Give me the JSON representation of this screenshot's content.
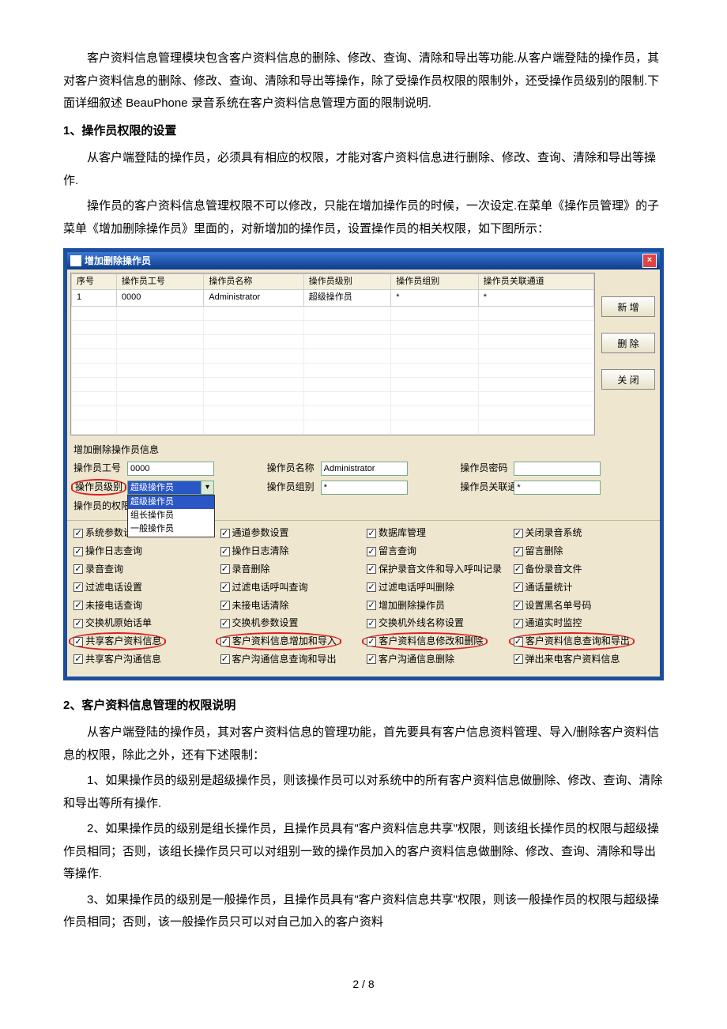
{
  "intro_p1": "客户资料信息管理模块包含客户资料信息的删除、修改、查询、清除和导出等功能.从客户端登陆的操作员，其对客户资料信息的删除、修改、查询、清除和导出等操作，除了受操作员权限的限制外，还受操作员级别的限制.下面详细叙述 BeauPhone 录音系统在客户资料信息管理方面的限制说明.",
  "h1": "1、操作员权限的设置",
  "s1_p1": "从客户端登陆的操作员，必须具有相应的权限，才能对客户资料信息进行删除、修改、查询、清除和导出等操作.",
  "s1_p2": "操作员的客户资料信息管理权限不可以修改，只能在增加操作员的时候，一次设定.在菜单《操作员管理》的子菜单《增加删除操作员》里面的，对新增加的操作员，设置操作员的相关权限，如下图所示：",
  "dlg": {
    "title": "增加删除操作员",
    "cols": [
      "序号",
      "操作员工号",
      "操作员名称",
      "操作员级别",
      "操作员组别",
      "操作员关联通道"
    ],
    "row": [
      "1",
      "0000",
      "Administrator",
      "超级操作员",
      "*",
      "*"
    ],
    "btn_add": "新 增",
    "btn_del": "删 除",
    "btn_close": "关 闭",
    "section": "增加删除操作员信息",
    "lbl_id": "操作员工号",
    "val_id": "0000",
    "lbl_name": "操作员名称",
    "val_name": "Administrator",
    "lbl_pwd": "操作员密码",
    "val_pwd": "",
    "lbl_level": "操作员级别",
    "val_level": "超级操作员",
    "opts": [
      "超级操作员",
      "组长操作员",
      "一般操作员"
    ],
    "lbl_group": "操作员组别",
    "val_group": "*",
    "lbl_chan": "操作员关联通道",
    "val_chan": "*",
    "lbl_perm": "操作员的权限",
    "perm_rows": [
      [
        "系统参数设置",
        "通道参数设置",
        "数据库管理",
        "关闭录音系统"
      ],
      [
        "操作日志查询",
        "操作日志清除",
        "留言查询",
        "留言删除"
      ],
      [
        "录音查询",
        "录音删除",
        "保护录音文件和导入呼叫记录",
        "备份录音文件"
      ],
      [
        "过滤电话设置",
        "过滤电话呼叫查询",
        "过滤电话呼叫删除",
        "通话量统计"
      ],
      [
        "未接电话查询",
        "未接电话清除",
        "增加删除操作员",
        "设置黑名单号码"
      ],
      [
        "交换机原始话单",
        "交换机参数设置",
        "交换机外线名称设置",
        "通道实时监控"
      ],
      [
        "共享客户资料信息",
        "客户资料信息增加和导入",
        "客户资料信息修改和删除",
        "客户资料信息查询和导出"
      ],
      [
        "共享客户沟通信息",
        "客户沟通信息查询和导出",
        "客户沟通信息删除",
        "弹出来电客户资料信息"
      ]
    ]
  },
  "h2": "2、客户资料信息管理的权限说明",
  "s2_p1": "从客户端登陆的操作员，其对客户资料信息的管理功能，首先要具有客户信息资料管理、导入/删除客户资料信息的权限，除此之外，还有下述限制：",
  "s2_p2": "1、如果操作员的级别是超级操作员，则该操作员可以对系统中的所有客户资料信息做删除、修改、查询、清除和导出等所有操作.",
  "s2_p3": "2、如果操作员的级别是组长操作员，且操作员具有\"客户资料信息共享\"权限，则该组长操作员的权限与超级操作员相同；否则，该组长操作员只可以对组别一致的操作员加入的客户资料信息做删除、修改、查询、清除和导出等操作.",
  "s2_p4": "3、如果操作员的级别是一般操作员，且操作员具有\"客户资料信息共享\"权限，则该一般操作员的权限与超级操作员相同；否则，该一般操作员只可以对自己加入的客户资料",
  "pager": "2 / 8"
}
